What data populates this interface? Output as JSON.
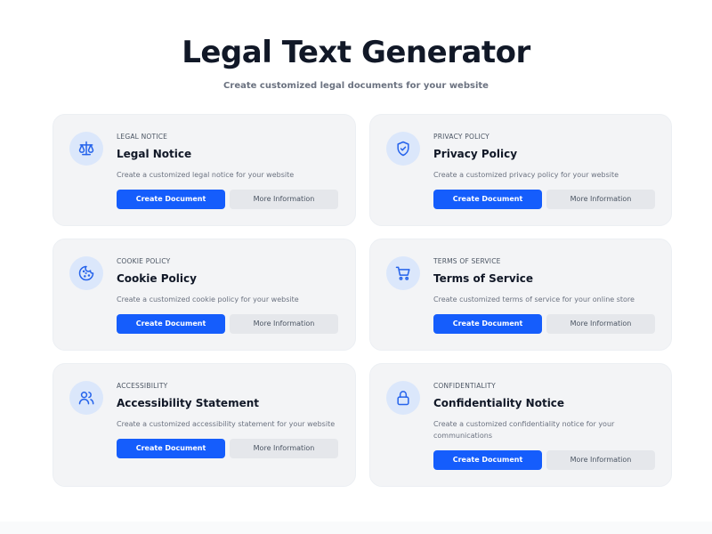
{
  "header": {
    "title": "Legal Text Generator",
    "subtitle": "Create customized legal documents for your website"
  },
  "cards": [
    {
      "category": "LEGAL NOTICE",
      "title": "Legal Notice",
      "description": "Create a customized legal notice for your website",
      "icon": "scale-icon",
      "primary_label": "Create Document",
      "secondary_label": "More Information"
    },
    {
      "category": "PRIVACY POLICY",
      "title": "Privacy Policy",
      "description": "Create a customized privacy policy for your website",
      "icon": "shield-check-icon",
      "primary_label": "Create Document",
      "secondary_label": "More Information"
    },
    {
      "category": "COOKIE POLICY",
      "title": "Cookie Policy",
      "description": "Create a customized cookie policy for your website",
      "icon": "cookie-icon",
      "primary_label": "Create Document",
      "secondary_label": "More Information"
    },
    {
      "category": "TERMS OF SERVICE",
      "title": "Terms of Service",
      "description": "Create customized terms of service for your online store",
      "icon": "shopping-cart-icon",
      "primary_label": "Create Document",
      "secondary_label": "More Information"
    },
    {
      "category": "ACCESSIBILITY",
      "title": "Accessibility Statement",
      "description": "Create a customized accessibility statement for your website",
      "icon": "users-icon",
      "primary_label": "Create Document",
      "secondary_label": "More Information"
    },
    {
      "category": "CONFIDENTIALITY",
      "title": "Confidentiality Notice",
      "description": "Create a customized confidentiality notice for your communications",
      "icon": "lock-icon",
      "primary_label": "Create Document",
      "secondary_label": "More Information"
    }
  ],
  "colors": {
    "accent": "#155dfc",
    "card_background": "#f3f4f6",
    "icon_background": "#dbe7fb",
    "secondary_button": "#e5e7eb"
  }
}
